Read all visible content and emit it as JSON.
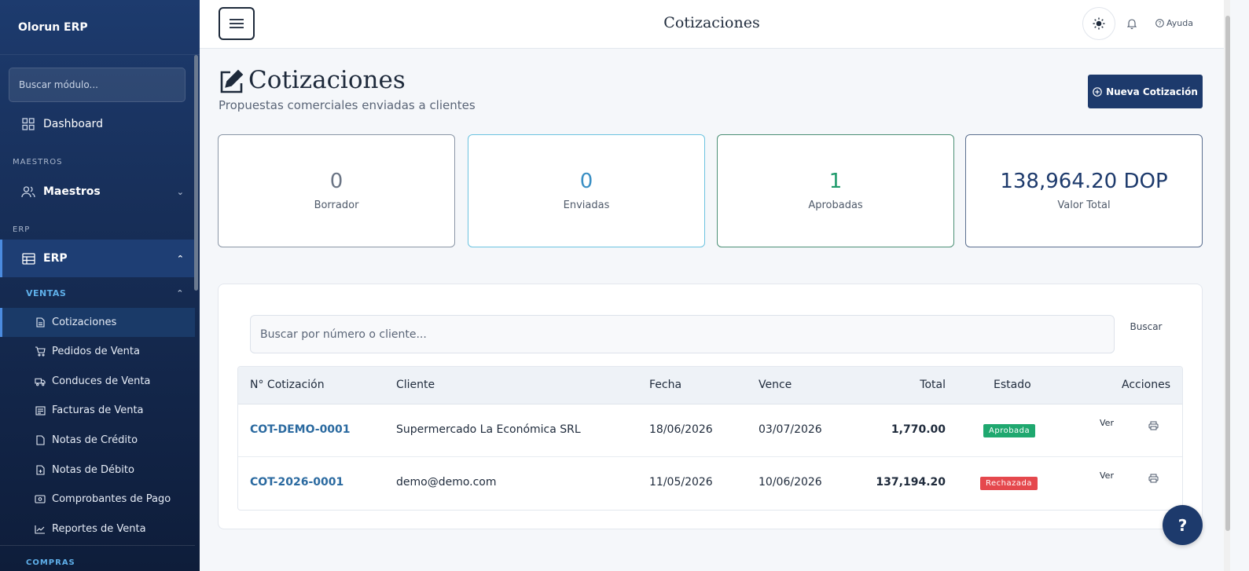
{
  "app": {
    "brand": "Olorun ERP"
  },
  "sidebar": {
    "search_placeholder": "Buscar módulo...",
    "dashboard": "Dashboard",
    "section_maestros": "MAESTROS",
    "maestros": "Maestros",
    "section_erp": "ERP",
    "erp": "ERP",
    "section_ventas": "VENTAS",
    "ventas_items": [
      {
        "label": "Cotizaciones",
        "icon": "document-icon"
      },
      {
        "label": "Pedidos de Venta",
        "icon": "cart-icon"
      },
      {
        "label": "Conduces de Venta",
        "icon": "truck-icon"
      },
      {
        "label": "Facturas de Venta",
        "icon": "invoice-icon"
      },
      {
        "label": "Notas de Crédito",
        "icon": "document-icon"
      },
      {
        "label": "Notas de Débito",
        "icon": "document-plus-icon"
      },
      {
        "label": "Comprobantes de Pago",
        "icon": "cash-icon"
      },
      {
        "label": "Reportes de Venta",
        "icon": "chart-line-icon"
      }
    ],
    "section_compras": "COMPRAS"
  },
  "topbar": {
    "title": "Cotizaciones",
    "help": "Ayuda"
  },
  "page": {
    "title": "Cotizaciones",
    "subtitle": "Propuestas comerciales enviadas a clientes",
    "new_button": "Nueva Cotización"
  },
  "stats": [
    {
      "value": "0",
      "label": "Borrador",
      "color": "#6b7585",
      "border": "#8a96a6"
    },
    {
      "value": "0",
      "label": "Enviadas",
      "color": "#3a8fc4",
      "border": "#6cc3e0"
    },
    {
      "value": "1",
      "label": "Aprobadas",
      "color": "#1f9a6b",
      "border": "#4b8f75"
    },
    {
      "value": "138,964.20 DOP",
      "label": "Valor Total",
      "color": "#1d3a6c",
      "border": "#5b6f8f"
    }
  ],
  "search": {
    "placeholder": "Buscar por número o cliente...",
    "button": "Buscar"
  },
  "table": {
    "headers": [
      "N° Cotización",
      "Cliente",
      "Fecha",
      "Vence",
      "Total",
      "Estado",
      "Acciones"
    ],
    "rows": [
      {
        "numero": "COT-DEMO-0001",
        "cliente": "Supermercado La Económica SRL",
        "fecha": "18/06/2026",
        "vence": "03/07/2026",
        "total": "1,770.00",
        "estado": "Aprobada",
        "estado_color": "#1fa86f",
        "accion": "Ver"
      },
      {
        "numero": "COT-2026-0001",
        "cliente": "demo@demo.com",
        "fecha": "11/05/2026",
        "vence": "10/06/2026",
        "total": "137,194.20",
        "estado": "Rechazada",
        "estado_color": "#e5484d",
        "accion": "Ver"
      }
    ]
  },
  "fab": {
    "label": "?"
  }
}
